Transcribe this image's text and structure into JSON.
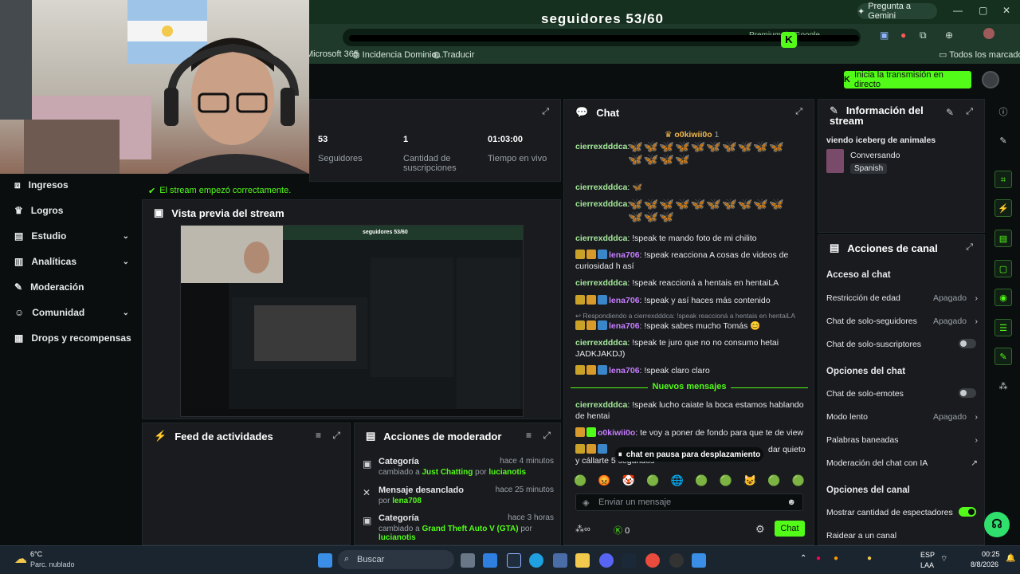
{
  "browser": {
    "gemini_label": "Pregunta a Gemini",
    "omnibox_badge": "Premium de Google",
    "bookmarks": [
      "Microsoft 365",
      "Incidencia Dominio...",
      "Traducir"
    ],
    "all_bookmarks": "Todos los marcadores"
  },
  "overlay": {
    "goal_text": "seguidores 53/60",
    "goal_progress": 0.883
  },
  "header": {
    "live_button": "Inicia la transmisión en directo"
  },
  "sidebar": {
    "items": [
      {
        "label": "Ingresos",
        "icon": "money-icon",
        "chevron": false
      },
      {
        "label": "Logros",
        "icon": "trophy-icon",
        "chevron": false
      },
      {
        "label": "Estudio",
        "icon": "studio-icon",
        "chevron": true
      },
      {
        "label": "Analíticas",
        "icon": "chart-icon",
        "chevron": true
      },
      {
        "label": "Moderación",
        "icon": "wrench-icon",
        "chevron": false
      },
      {
        "label": "Comunidad",
        "icon": "community-icon",
        "chevron": true
      },
      {
        "label": "Drops y recompensas",
        "icon": "drops-icon",
        "chevron": false
      }
    ]
  },
  "stats": {
    "items": [
      {
        "value": "53",
        "label": "Seguidores"
      },
      {
        "value": "1",
        "label": "Cantidad de suscripciones"
      },
      {
        "value": "01:03:00",
        "label": "Tiempo en vivo"
      }
    ],
    "ok_message": "El stream empezó correctamente."
  },
  "preview": {
    "title": "Vista previa del stream",
    "mini_goal": "seguidores 53/60"
  },
  "feed": {
    "title": "Feed de actividades"
  },
  "mod_actions": {
    "title": "Acciones de moderador",
    "rows": [
      {
        "title": "Categoría",
        "prefix": "cambiado a",
        "target": "Just Chatting",
        "by_word": "por",
        "user": "lucianotis",
        "time": "hace 4 minutos"
      },
      {
        "title": "Mensaje desanclado",
        "prefix": "",
        "target": "",
        "by_word": "por",
        "user": "lena708",
        "time": "hace 25 minutos"
      },
      {
        "title": "Categoría",
        "prefix": "cambiado a",
        "target": "Grand Theft Auto V (GTA)",
        "by_word": "por",
        "user": "lucianotis",
        "time": "hace 3 horas"
      }
    ]
  },
  "chat": {
    "title": "Chat",
    "pinned_user": "o0kiwii0o",
    "pinned_count": "1",
    "messages": [
      {
        "user": "cierrexdddca",
        "text": ""
      },
      {
        "user": "cierrexdddca",
        "text": ""
      },
      {
        "user": "cierrexdddca",
        "text": ""
      },
      {
        "user": "cierrexdddca",
        "text": "!speak te mando foto de mi chilito"
      },
      {
        "user": "lena706",
        "text": "!speak reacciona A cosas de videos de curiosidad h así"
      },
      {
        "user": "cierrexdddca",
        "text": "!speak reaccioná a hentais en hentaiLA"
      },
      {
        "user": "lena706",
        "text": "!speak y así haces más contenido"
      },
      {
        "reply": "Respondiendo a cierrexdddca: !speak reaccioná a hentais en hentaiLA",
        "user": "lena706",
        "text": "!speak sabes mucho Tomás 😊"
      },
      {
        "user": "cierrexdddca",
        "text": "!speak te juro que no no consumo hetai JADKJAKDJ)"
      },
      {
        "user": "lena706",
        "text": "!speak claro claro"
      },
      {
        "user": "cierrexdddca",
        "text": "!speak lucho caiate la boca estamos hablando de hentai"
      },
      {
        "user": "o0kiwii0o",
        "text": "te voy a poner de fondo para que te de view"
      },
      {
        "user": "",
        "text": "y cállarte 5 segundos"
      }
    ],
    "new_messages": "Nuevos mensajes",
    "paused": "chat en pausa para desplazamiento",
    "input_placeholder": "Enviar un mensaje",
    "send_label": "Chat",
    "points": "0",
    "partial_text": "dar quieto"
  },
  "stream_info": {
    "title": "Información del stream",
    "stream_title": "viendo iceberg de animales",
    "category": "Conversando",
    "language": "Spanish"
  },
  "channel_actions": {
    "title": "Acciones de canal",
    "sections": [
      {
        "header": "Acceso al chat"
      },
      {
        "label": "Restricción de edad",
        "value": "Apagado",
        "type": "select"
      },
      {
        "label": "Chat de solo-seguidores",
        "value": "Apagado",
        "type": "select"
      },
      {
        "label": "Chat de solo-suscriptores",
        "type": "toggle",
        "on": false
      },
      {
        "header": "Opciones del chat"
      },
      {
        "label": "Chat de solo-emotes",
        "type": "toggle",
        "on": false
      },
      {
        "label": "Modo lento",
        "value": "Apagado",
        "type": "select"
      },
      {
        "label": "Palabras baneadas",
        "type": "link"
      },
      {
        "label": "Moderación del chat con IA",
        "type": "external"
      },
      {
        "header": "Opciones del canal"
      },
      {
        "label": "Mostrar cantidad de espectadores",
        "type": "toggle",
        "on": true
      },
      {
        "label": "Raidear a un canal",
        "type": "plain"
      }
    ]
  },
  "taskbar": {
    "weather_temp": "6°C",
    "weather_desc": "Parc. nublado",
    "search": "Buscar",
    "lang1": "ESP",
    "lang2": "LAA",
    "time": "00:25",
    "date": "8/8/2026"
  },
  "colors": {
    "accent": "#53fc18",
    "panel": "#191b1f",
    "bg": "#0b0e0f"
  }
}
